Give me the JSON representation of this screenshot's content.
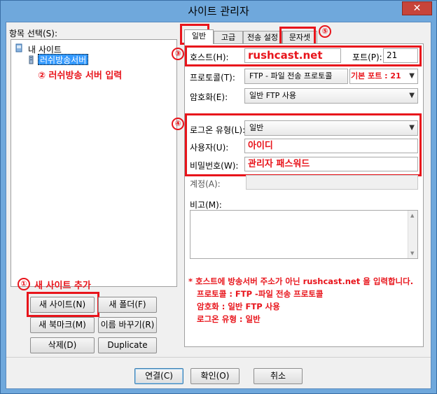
{
  "window": {
    "title": "사이트 관리자",
    "close_glyph": "✕"
  },
  "left": {
    "tree_label": "항목 선택(S):",
    "tree": {
      "root": "내 사이트",
      "child": "러쉬방송서버"
    },
    "annotation_server": "② 러쉬방송 서버 입력",
    "annotation_new_site": "새 사이트 추가",
    "annotation_new_site_num": "①",
    "buttons": {
      "new_site": "새 사이트(N)",
      "new_folder": "새 폴더(F)",
      "new_bookmark": "새 북마크(M)",
      "rename": "이름 바꾸기(R)",
      "delete": "삭제(D)",
      "duplicate": "Duplicate"
    }
  },
  "tabs": [
    {
      "label": "일반"
    },
    {
      "label": "고급"
    },
    {
      "label": "전송 설정"
    },
    {
      "label": "문자셋"
    }
  ],
  "general": {
    "host_label": "호스트(H):",
    "host_value": "rushcast.net",
    "port_label": "포트(P):",
    "port_value": "21",
    "default_port_note": "기본 포트 : 21",
    "protocol_label": "프로토콜(T):",
    "protocol_value": "FTP - 파일 전송 프로토콜",
    "encryption_label": "암호화(E):",
    "encryption_value": "일반 FTP 사용",
    "logon_label": "로그온 유형(L):",
    "logon_value": "일반",
    "user_label": "사용자(U):",
    "user_value": "아이디",
    "password_label": "비밀번호(W):",
    "password_value": "관리자 패스워드",
    "account_label": "계정(A):",
    "comment_label": "비고(M):"
  },
  "badges": {
    "host": "③",
    "login": "④",
    "charset": "⑤"
  },
  "notes": [
    "* 호스트에 방송서버 주소가 아닌 rushcast.net 을 입력합니다.",
    "프로토콜 : FTP -파일 전송 프로토콜",
    "암호화 : 일반 FTP 사용",
    "로그온 유형 : 일반"
  ],
  "footer": {
    "connect": "연결(C)",
    "ok": "확인(O)",
    "cancel": "취소"
  },
  "icons": {
    "chevron": "chevron-down-icon",
    "computer": "computer-icon",
    "server": "server-icon"
  },
  "colors": {
    "annotation": "#e8141b",
    "title_bar": "#6fa8dc",
    "selection": "#3399ff"
  }
}
